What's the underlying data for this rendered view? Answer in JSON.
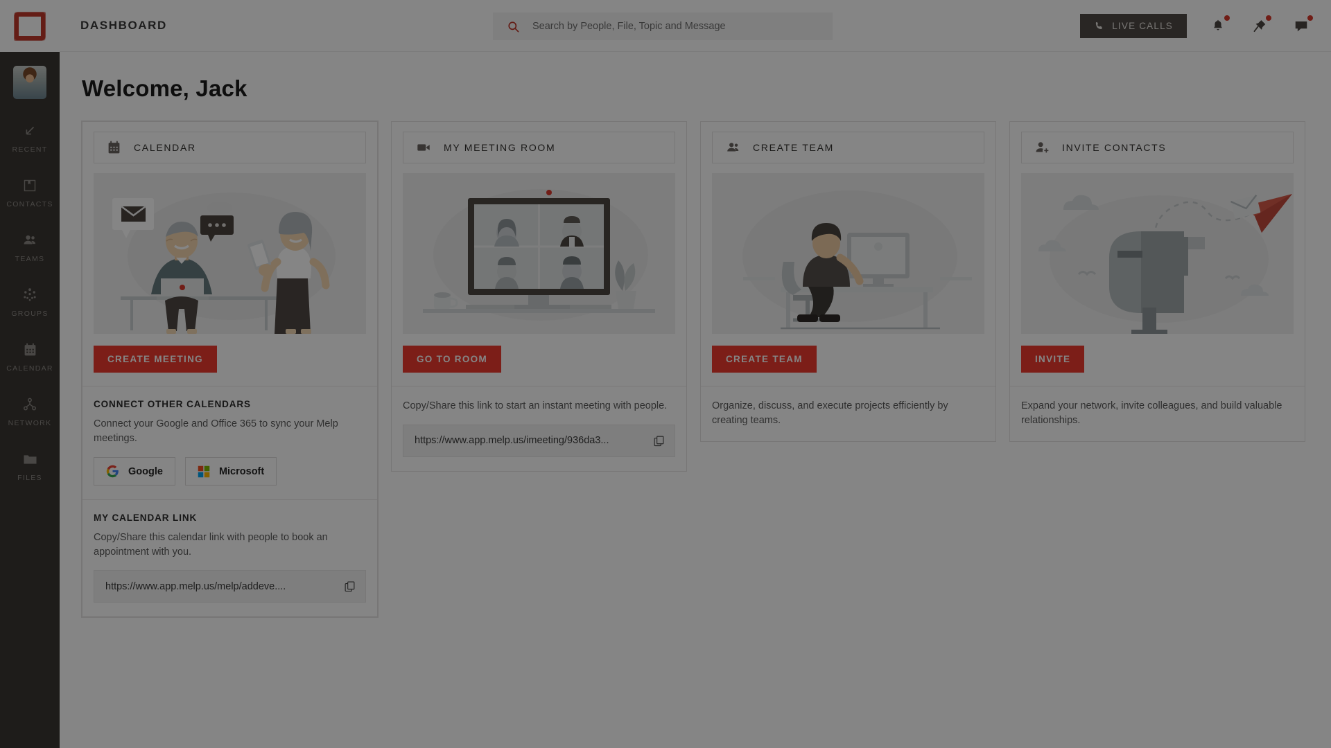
{
  "app": {
    "brand_color": "#c0392b",
    "accent_color": "#ee3b2e",
    "sidebar_bg": "#3b3733"
  },
  "topbar": {
    "page_title": "DASHBOARD",
    "search": {
      "placeholder": "Search by People, File, Topic and Message",
      "value": "",
      "icon": "search-icon"
    },
    "live_calls_label": "LIVE CALLS",
    "icons": [
      {
        "name": "bell-icon",
        "has_badge": true
      },
      {
        "name": "pin-icon",
        "has_badge": true
      },
      {
        "name": "chat-icon",
        "has_badge": true
      }
    ]
  },
  "sidebar": {
    "logo_name": "melp-logo",
    "avatar_name": "user-avatar",
    "items": [
      {
        "label": "RECENT",
        "icon": "arrow-down-left-icon"
      },
      {
        "label": "CONTACTS",
        "icon": "contact-card-icon"
      },
      {
        "label": "TEAMS",
        "icon": "people-icon"
      },
      {
        "label": "GROUPS",
        "icon": "group-dots-icon"
      },
      {
        "label": "CALENDAR",
        "icon": "calendar-icon"
      },
      {
        "label": "NETWORK",
        "icon": "network-icon"
      },
      {
        "label": "FILES",
        "icon": "folder-icon"
      }
    ]
  },
  "main": {
    "welcome": "Welcome, Jack",
    "cards": {
      "calendar": {
        "header": "CALENDAR",
        "header_icon": "calendar-icon",
        "cta": "CREATE MEETING",
        "connect_title": "CONNECT OTHER CALENDARS",
        "connect_desc": "Connect your Google and Office 365 to sync your Melp meetings.",
        "google_label": "Google",
        "microsoft_label": "Microsoft",
        "link_title": "MY CALENDAR LINK",
        "link_desc": "Copy/Share this calendar link with people to book an appointment with you.",
        "link_value": "https://www.app.melp.us/melp/addeve...."
      },
      "meeting_room": {
        "header": "MY MEETING ROOM",
        "header_icon": "video-camera-icon",
        "cta": "GO TO ROOM",
        "desc": "Copy/Share this link to start an instant meeting with people.",
        "link_value": "https://www.app.melp.us/imeeting/936da3..."
      },
      "create_team": {
        "header": "CREATE TEAM",
        "header_icon": "team-icon",
        "cta": "CREATE TEAM",
        "desc": "Organize, discuss, and execute projects efficiently by creating teams."
      },
      "invite_contacts": {
        "header": "INVITE CONTACTS",
        "header_icon": "user-plus-icon",
        "cta": "INVITE",
        "desc": "Expand your network, invite colleagues, and build valuable relationships."
      }
    }
  }
}
